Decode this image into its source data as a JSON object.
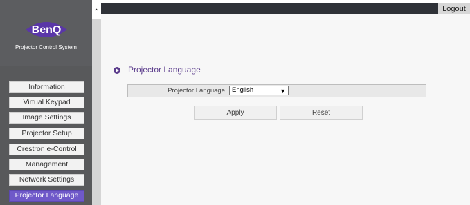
{
  "app": {
    "logo_text": "BenQ",
    "system_title": "Projector Control System"
  },
  "header": {
    "logout_label": "Logout"
  },
  "sidebar": {
    "items": [
      {
        "label": "Information"
      },
      {
        "label": "Virtual Keypad"
      },
      {
        "label": "Image Settings"
      },
      {
        "label": "Projector Setup"
      },
      {
        "label": "Crestron e-Control"
      },
      {
        "label": "Management"
      },
      {
        "label": "Network Settings"
      },
      {
        "label": "Projector Language",
        "active": true
      }
    ]
  },
  "main": {
    "section_title": "Projector Language",
    "field": {
      "label": "Projector Language",
      "selected_value": "English"
    },
    "buttons": {
      "apply_label": "Apply",
      "reset_label": "Reset"
    }
  },
  "colors": {
    "accent": "#6f59c9",
    "section_title": "#5b3c8c",
    "sidebar_bg": "#58595b",
    "topbar_bg": "#2f3238"
  },
  "icons": [
    "benq-logo",
    "chevron-up-icon",
    "play-circle-icon",
    "chevron-down-icon"
  ]
}
